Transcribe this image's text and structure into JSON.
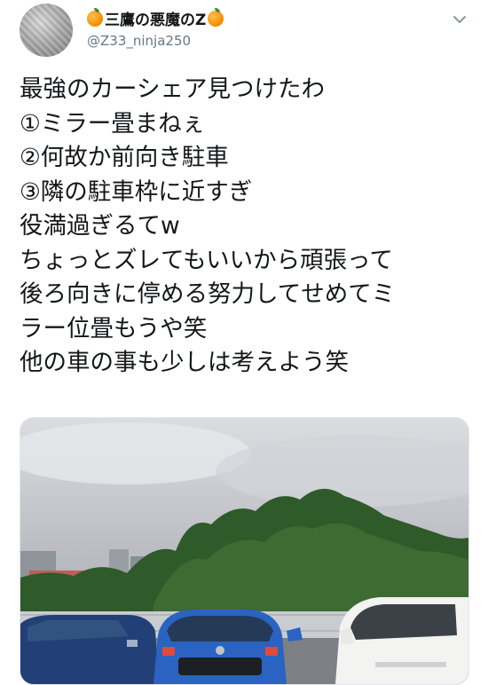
{
  "user": {
    "display_name": "三鷹の悪魔のZ",
    "handle": "@Z33_ninja250"
  },
  "tweet": {
    "lines": [
      "最強のカーシェア見つけたわ",
      "①ミラー畳まねぇ",
      "②何故か前向き駐車",
      "③隣の駐車枠に近すぎ",
      "役満過ぎるてw",
      "ちょっとズレてもいいから頑張って",
      "後ろ向きに停める努力してせめてミ",
      "ラー位畳もうや笑",
      "他の車の事も少しは考えよう笑"
    ]
  },
  "icons": {
    "name_prefix": "orange-emoji-icon",
    "name_suffix": "orange-emoji-icon",
    "menu": "chevron-down-icon"
  },
  "colors": {
    "text": "#14171a",
    "handle": "#657786",
    "accent_orange": "#f08c00"
  }
}
